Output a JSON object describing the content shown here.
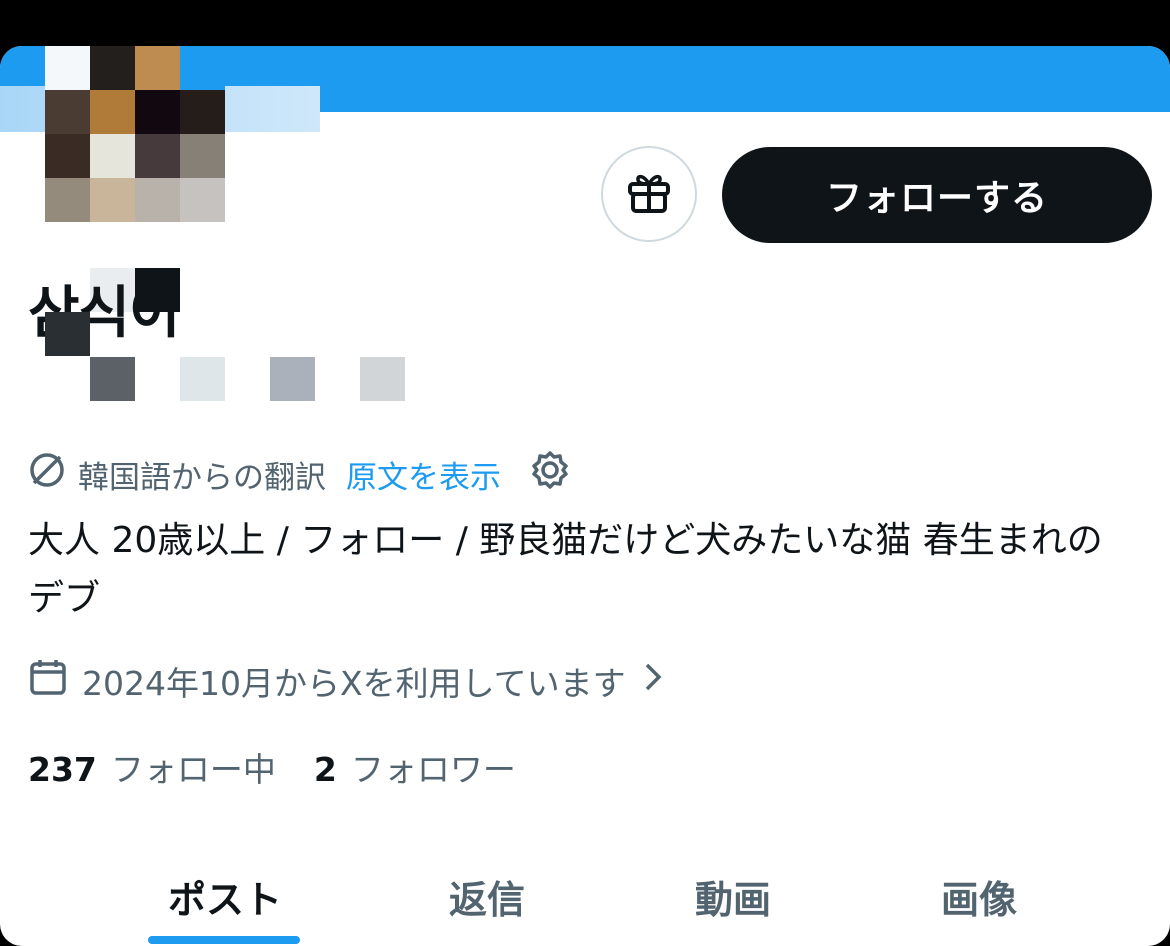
{
  "header": {
    "banner_color": "#1d9bf0"
  },
  "actions": {
    "gift_icon": "gift-icon",
    "follow_label": "フォローする"
  },
  "profile": {
    "display_name": "삼식이",
    "translation": {
      "label": "韓国語からの翻訳",
      "show_original": "原文を表示"
    },
    "bio": "大人 20歳以上 / フォロー / 野良猫だけど犬みたいな猫 春生まれのデブ",
    "joined": "2024年10月からXを利用しています",
    "following_count": "237",
    "following_label": "フォロー中",
    "followers_count": "2",
    "followers_label": "フォロワー"
  },
  "tabs": [
    {
      "label": "ポスト",
      "active": true
    },
    {
      "label": "返信",
      "active": false
    },
    {
      "label": "動画",
      "active": false
    },
    {
      "label": "画像",
      "active": false
    }
  ],
  "colors": {
    "accent": "#1d9bf0",
    "text_primary": "#0f1419",
    "text_secondary": "#536471"
  }
}
